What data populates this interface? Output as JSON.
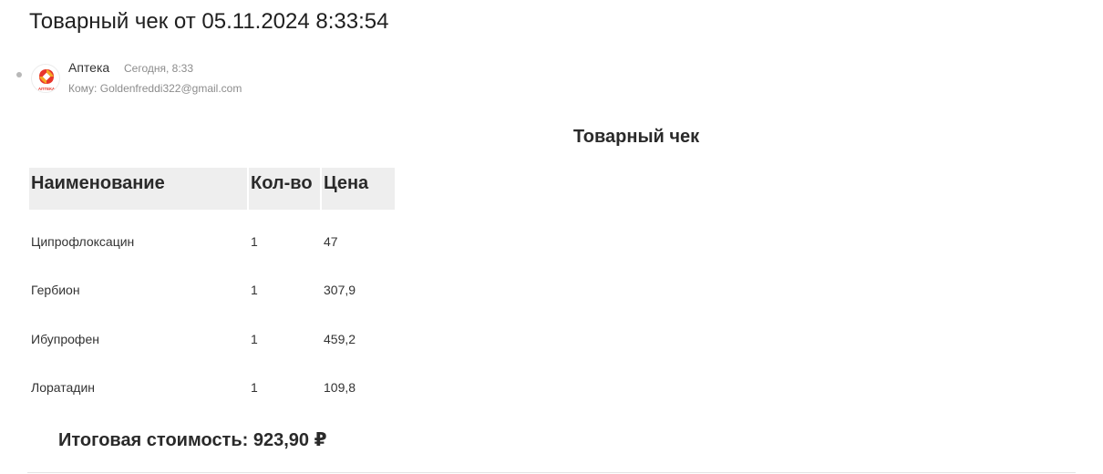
{
  "email": {
    "subject": "Товарный чек от 05.11.2024 8:33:54",
    "sender": {
      "name": "Аптека",
      "time": "Сегодня, 8:33",
      "avatar_icon": "pharmacy-logo-icon",
      "avatar_text": "АПТЕКА"
    },
    "recipient": {
      "label": "Кому:",
      "address": "Goldenfreddi322@gmail.com"
    }
  },
  "receipt": {
    "title": "Товарный чек",
    "columns": [
      "Наименование",
      "Кол-во",
      "Цена"
    ],
    "rows": [
      {
        "name": "Ципрофлоксацин",
        "qty": "1",
        "price": "47"
      },
      {
        "name": "Гербион",
        "qty": "1",
        "price": "307,9"
      },
      {
        "name": "Ибупрофен",
        "qty": "1",
        "price": "459,2"
      },
      {
        "name": "Лоратадин",
        "qty": "1",
        "price": "109,8"
      }
    ],
    "total": "Итоговая стоимость: 923,90 ₽"
  },
  "colors": {
    "header_bg": "#eeeeee",
    "logo_primary": "#e8352b",
    "logo_secondary": "#f5a623"
  }
}
